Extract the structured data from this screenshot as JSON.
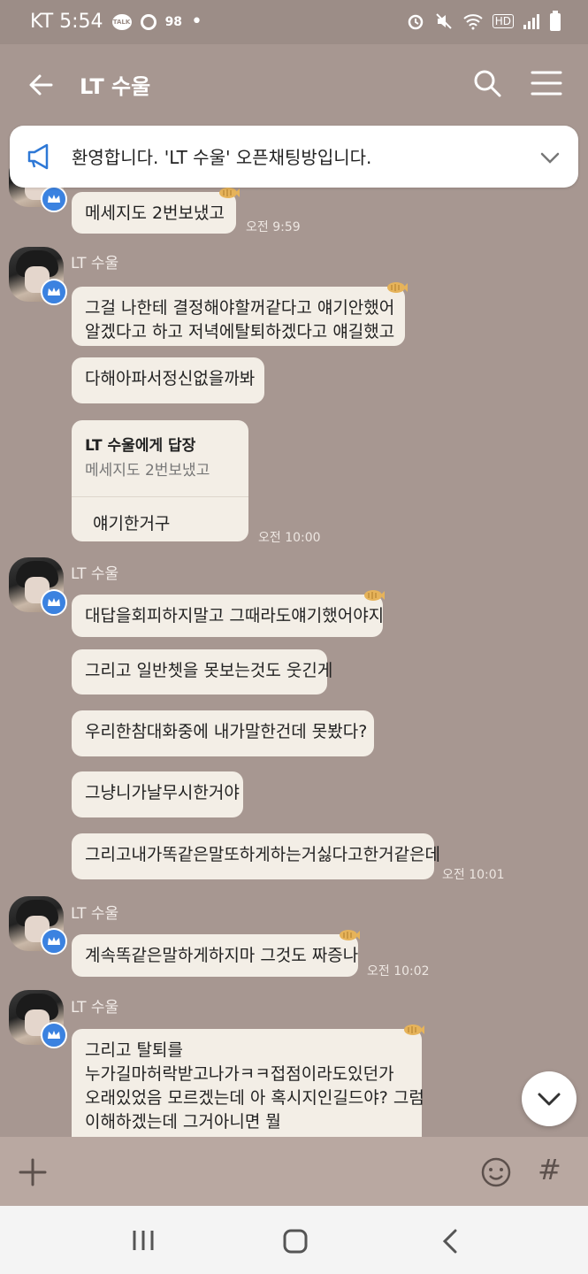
{
  "status_bar": {
    "carrier_time": "KT 5:54",
    "talk_badge": "TALK",
    "signal_badge": "98",
    "dot": "•",
    "hd_label": "HD",
    "icons": [
      "kakaotalk-icon",
      "data-icon",
      "alarm-icon",
      "mute-icon",
      "wifi-icon",
      "signal-icon",
      "battery-icon"
    ]
  },
  "header": {
    "title": "LT 수울",
    "icons": [
      "back-arrow-icon",
      "search-icon",
      "menu-icon"
    ]
  },
  "notice": {
    "text": "환영합니다. 'LT 수울' 오픈채팅방입니다.",
    "icons": [
      "megaphone-icon",
      "chevron-down-icon"
    ]
  },
  "messages": {
    "m0": {
      "text": "메세지도 2번보냈고",
      "time": "오전 9:59"
    },
    "g1": {
      "sender": "LT 수울",
      "m1": {
        "text": "그걸 나한테 결정해야할꺼같다고 얘기안했어\n알겠다고 하고 저녁에탈퇴하겠다고 얘길했고"
      },
      "m2": {
        "text": "다해아파서정신없을까봐"
      },
      "reply": {
        "title": "LT 수울에게 답장",
        "quote": "메세지도 2번보냈고",
        "body": "얘기한거구",
        "time": "오전 10:00"
      }
    },
    "g2": {
      "sender": "LT 수울",
      "m1": {
        "text": "대답을회피하지말고 그때라도얘기했어야지"
      },
      "m2": {
        "text": "그리고 일반쳇을 못보는것도 웃긴게"
      },
      "m3": {
        "text": "우리한참대화중에 내가말한건데 못봤다?"
      },
      "m4": {
        "text": "그냥니가날무시한거야"
      },
      "m5": {
        "text": "그리고내가똑같은말또하게하는거싫다고한거같은데",
        "time": "오전 10:01"
      }
    },
    "g3": {
      "sender": "LT 수울",
      "m1": {
        "text": "계속똑같은말하게하지마 그것도 짜증나",
        "time": "오전 10:02"
      }
    },
    "g4": {
      "sender": "LT 수울",
      "m1": {
        "text": "그리고 탈퇴를\n누가길마허락받고나가ㅋㅋ접점이라도있던가\n오래있었음 모르겠는데 아 혹시지인길드야? 그럼\n이해하겠는데 그거아니면 뭘\n허락을받아야하는지도이해못하겠다"
      }
    }
  },
  "input_bar": {
    "hash_label": "#",
    "icons": [
      "plus-icon",
      "emoji-icon"
    ]
  },
  "system_nav": {
    "icons": [
      "recent-apps-icon",
      "home-icon",
      "nav-back-icon"
    ]
  },
  "colors": {
    "background": "#a79791",
    "bubble": "#f3eee6",
    "notice": "#ffffff",
    "crown_badge": "#3b82e0"
  }
}
